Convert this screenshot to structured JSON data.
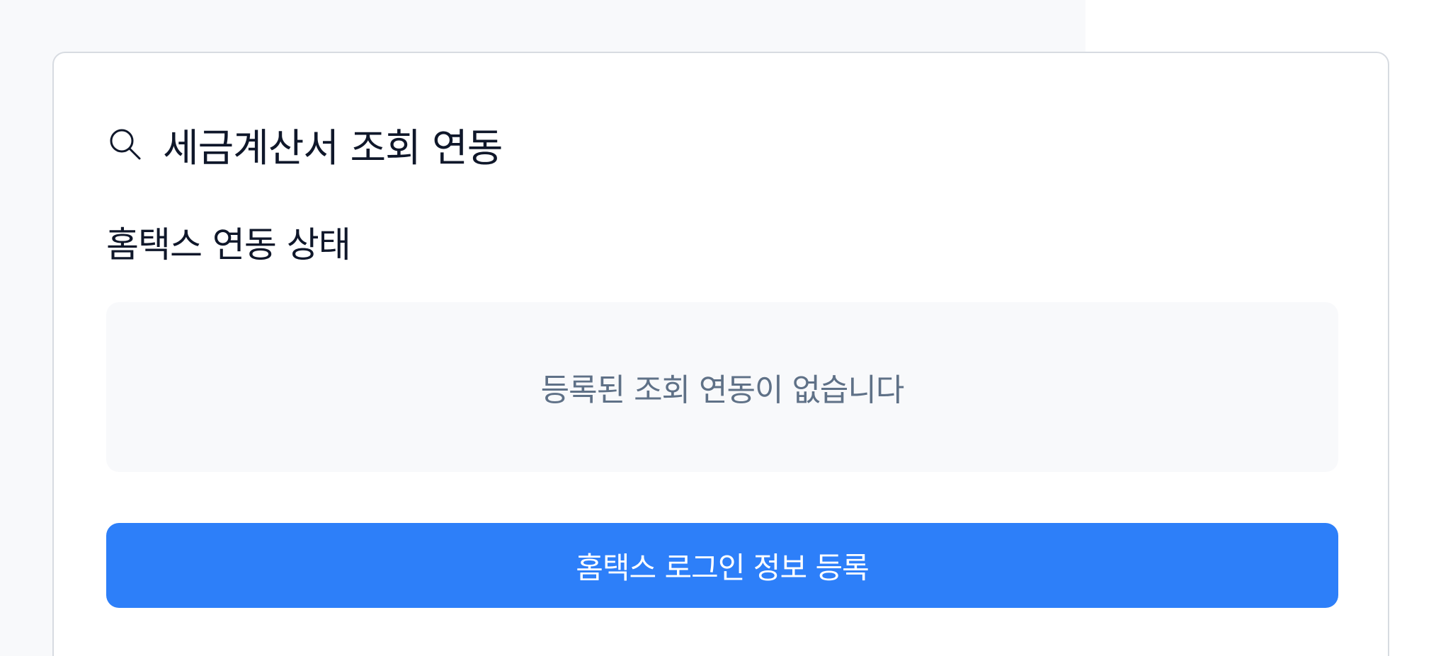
{
  "card": {
    "title": "세금계산서 조회 연동",
    "title_icon": "search-icon"
  },
  "hometax_status": {
    "section_title": "홈택스 연동 상태",
    "empty_message": "등록된 조회 연동이 없습니다"
  },
  "actions": {
    "register_button_label": "홈택스 로그인 정보 등록"
  },
  "colors": {
    "page_background": "#f8f9fb",
    "card_border": "#d7dbe1",
    "primary_blue": "#2d7ff9",
    "title_text": "#0f172a",
    "muted_text": "#5f7187"
  }
}
